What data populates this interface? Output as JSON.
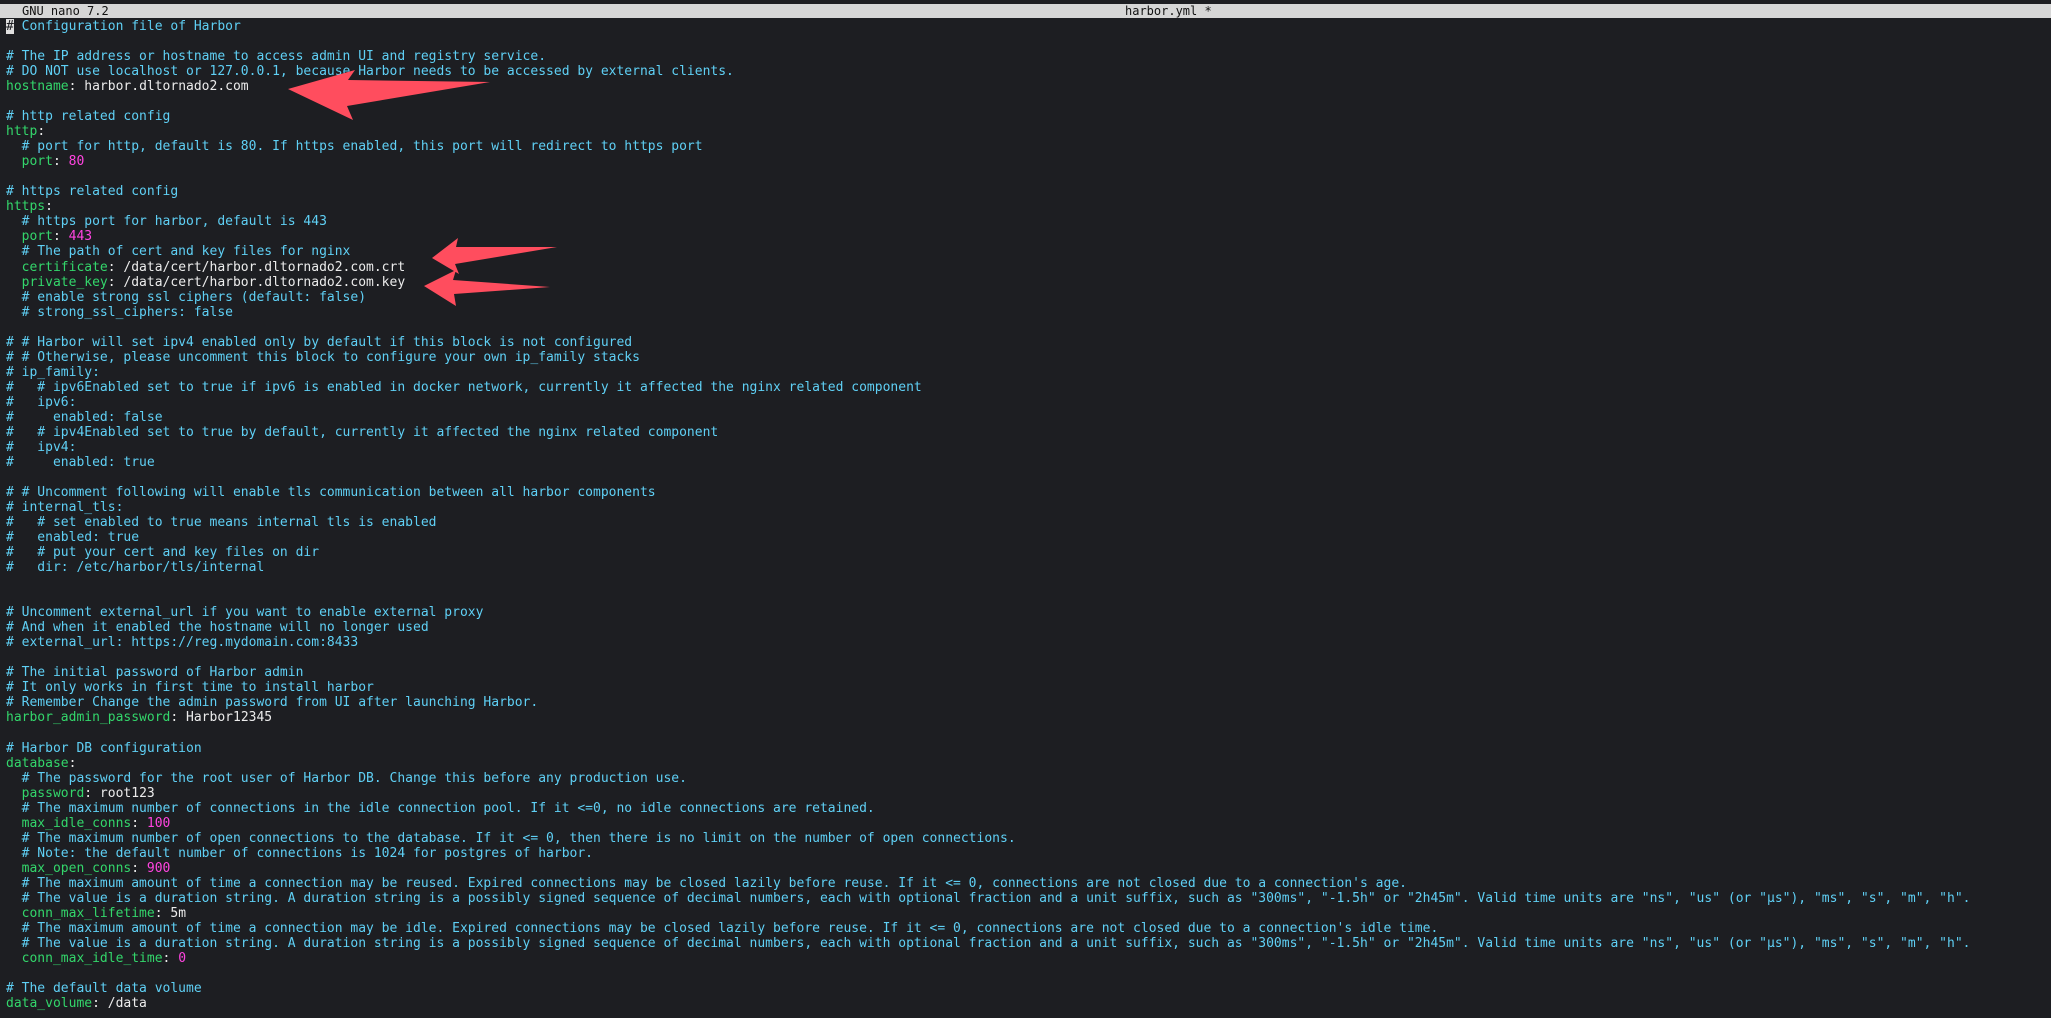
{
  "titlebar": {
    "app": "GNU nano 7.2",
    "filename": "harbor.yml *"
  },
  "lines": [
    [
      [
        "#",
        "cursor"
      ],
      [
        " Configuration file of Harbor",
        "c"
      ]
    ],
    [],
    [
      [
        "# The IP address or hostname to access admin UI and registry service.",
        "c"
      ]
    ],
    [
      [
        "# DO NOT use localhost or 127.0.0.1, because Harbor needs to be accessed by external clients.",
        "c"
      ]
    ],
    [
      [
        "hostname",
        "k"
      ],
      [
        ": harbor.dltornado2.com",
        "v"
      ]
    ],
    [],
    [
      [
        "# http related config",
        "c"
      ]
    ],
    [
      [
        "http",
        "k"
      ],
      [
        ":",
        "v"
      ]
    ],
    [
      [
        "  # port for http, default is 80. If https enabled, this port will redirect to https port",
        "c"
      ]
    ],
    [
      [
        "  port",
        "k"
      ],
      [
        ": ",
        "v"
      ],
      [
        "80",
        "n"
      ]
    ],
    [],
    [
      [
        "# https related config",
        "c"
      ]
    ],
    [
      [
        "https",
        "k"
      ],
      [
        ":",
        "v"
      ]
    ],
    [
      [
        "  # https port for harbor, default is 443",
        "c"
      ]
    ],
    [
      [
        "  port",
        "k"
      ],
      [
        ": ",
        "v"
      ],
      [
        "443",
        "n"
      ]
    ],
    [
      [
        "  # The path of cert and key files for nginx",
        "c"
      ]
    ],
    [
      [
        "  certificate",
        "k"
      ],
      [
        ": /data/cert/harbor.dltornado2.com.crt",
        "v"
      ]
    ],
    [
      [
        "  private_key",
        "k"
      ],
      [
        ": /data/cert/harbor.dltornado2.com.key",
        "v"
      ]
    ],
    [
      [
        "  # enable strong ssl ciphers (default: false)",
        "c"
      ]
    ],
    [
      [
        "  # strong_ssl_ciphers: false",
        "c"
      ]
    ],
    [],
    [
      [
        "# # Harbor will set ipv4 enabled only by default if this block is not configured",
        "c"
      ]
    ],
    [
      [
        "# # Otherwise, please uncomment this block to configure your own ip_family stacks",
        "c"
      ]
    ],
    [
      [
        "# ip_family:",
        "c"
      ]
    ],
    [
      [
        "#   # ipv6Enabled set to true if ipv6 is enabled in docker network, currently it affected the nginx related component",
        "c"
      ]
    ],
    [
      [
        "#   ipv6:",
        "c"
      ]
    ],
    [
      [
        "#     enabled: false",
        "c"
      ]
    ],
    [
      [
        "#   # ipv4Enabled set to true by default, currently it affected the nginx related component",
        "c"
      ]
    ],
    [
      [
        "#   ipv4:",
        "c"
      ]
    ],
    [
      [
        "#     enabled: true",
        "c"
      ]
    ],
    [],
    [
      [
        "# # Uncomment following will enable tls communication between all harbor components",
        "c"
      ]
    ],
    [
      [
        "# internal_tls:",
        "c"
      ]
    ],
    [
      [
        "#   # set enabled to true means internal tls is enabled",
        "c"
      ]
    ],
    [
      [
        "#   enabled: true",
        "c"
      ]
    ],
    [
      [
        "#   # put your cert and key files on dir",
        "c"
      ]
    ],
    [
      [
        "#   dir: /etc/harbor/tls/internal",
        "c"
      ]
    ],
    [],
    [],
    [
      [
        "# Uncomment external_url if you want to enable external proxy",
        "c"
      ]
    ],
    [
      [
        "# And when it enabled the hostname will no longer used",
        "c"
      ]
    ],
    [
      [
        "# external_url: https://reg.mydomain.com:8433",
        "c"
      ]
    ],
    [],
    [
      [
        "# The initial password of Harbor admin",
        "c"
      ]
    ],
    [
      [
        "# It only works in first time to install harbor",
        "c"
      ]
    ],
    [
      [
        "# Remember Change the admin password from UI after launching Harbor.",
        "c"
      ]
    ],
    [
      [
        "harbor_admin_password",
        "k"
      ],
      [
        ": Harbor12345",
        "v"
      ]
    ],
    [],
    [
      [
        "# Harbor DB configuration",
        "c"
      ]
    ],
    [
      [
        "database",
        "k"
      ],
      [
        ":",
        "v"
      ]
    ],
    [
      [
        "  # The password for the root user of Harbor DB. Change this before any production use.",
        "c"
      ]
    ],
    [
      [
        "  password",
        "k"
      ],
      [
        ": root123",
        "v"
      ]
    ],
    [
      [
        "  # The maximum number of connections in the idle connection pool. If it <=0, no idle connections are retained.",
        "c"
      ]
    ],
    [
      [
        "  max_idle_conns",
        "k"
      ],
      [
        ": ",
        "v"
      ],
      [
        "100",
        "n"
      ]
    ],
    [
      [
        "  # The maximum number of open connections to the database. If it <= 0, then there is no limit on the number of open connections.",
        "c"
      ]
    ],
    [
      [
        "  # Note: the default number of connections is 1024 for postgres of harbor.",
        "c"
      ]
    ],
    [
      [
        "  max_open_conns",
        "k"
      ],
      [
        ": ",
        "v"
      ],
      [
        "900",
        "n"
      ]
    ],
    [
      [
        "  # The maximum amount of time a connection may be reused. Expired connections may be closed lazily before reuse. If it <= 0, connections are not closed due to a connection's age.",
        "c"
      ]
    ],
    [
      [
        "  # The value is a duration string. A duration string is a possibly signed sequence of decimal numbers, each with optional fraction and a unit suffix, such as \"300ms\", \"-1.5h\" or \"2h45m\". Valid time units are \"ns\", \"us\" (or \"µs\"), \"ms\", \"s\", \"m\", \"h\".",
        "c"
      ]
    ],
    [
      [
        "  conn_max_lifetime",
        "k"
      ],
      [
        ": 5m",
        "v"
      ]
    ],
    [
      [
        "  # The maximum amount of time a connection may be idle. Expired connections may be closed lazily before reuse. If it <= 0, connections are not closed due to a connection's idle time.",
        "c"
      ]
    ],
    [
      [
        "  # The value is a duration string. A duration string is a possibly signed sequence of decimal numbers, each with optional fraction and a unit suffix, such as \"300ms\", \"-1.5h\" or \"2h45m\". Valid time units are \"ns\", \"us\" (or \"µs\"), \"ms\", \"s\", \"m\", \"h\".",
        "c"
      ]
    ],
    [
      [
        "  conn_max_idle_time",
        "k"
      ],
      [
        ": ",
        "v"
      ],
      [
        "0",
        "n"
      ]
    ],
    [],
    [
      [
        "# The default data volume",
        "c"
      ]
    ],
    [
      [
        "data_volume",
        "k"
      ],
      [
        ": /data",
        "v"
      ]
    ]
  ],
  "colors": {
    "comment": "#5fd0f5",
    "key": "#33d66b",
    "number": "#ff44e0",
    "value": "#ececec",
    "arrow": "#ff4d5e",
    "background": "#1d1e22"
  }
}
